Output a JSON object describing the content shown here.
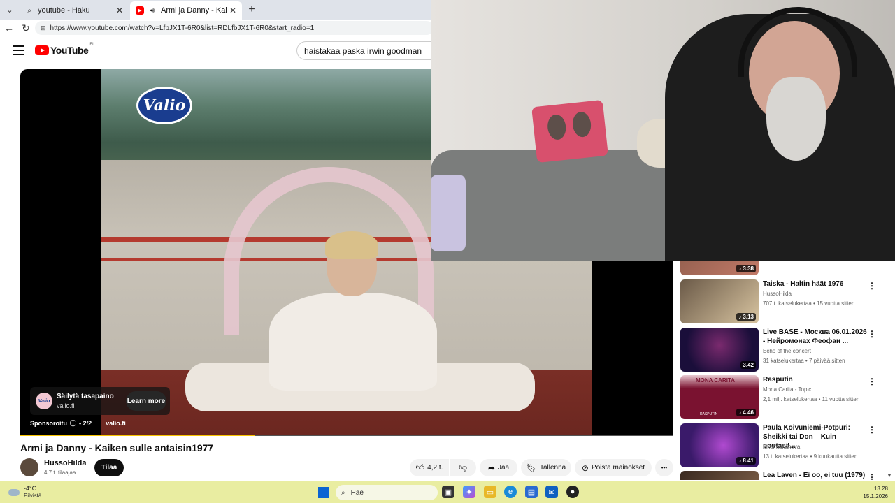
{
  "browser": {
    "tabs": [
      {
        "title": "youtube - Haku",
        "active": false
      },
      {
        "title": "Armi ja Danny - Kaiken sulle a",
        "active": true
      }
    ],
    "url": "https://www.youtube.com/watch?v=LfbJX1T-6R0&list=RDLfbJX1T-6R0&start_radio=1"
  },
  "youtube": {
    "logo": "YouTube",
    "region": "FI",
    "search_query": "haistakaa paska irwin goodman"
  },
  "ad": {
    "brand_logo_text": "Valio",
    "card_title": "Säilytä tasapaino",
    "card_domain": "valio.fi",
    "avatar_text": "Valio",
    "learn_more": "Learn more",
    "sponsored": "Sponsoroitu",
    "info_icon": "ⓘ",
    "counter": "• 2/2",
    "domain": "valio.fi",
    "progress": 0.36
  },
  "video": {
    "title": "Armi ja Danny - Kaiken sulle antaisin1977",
    "channel": "HussoHilda",
    "subscribers": "4,7 t. tilaajaa",
    "subscribe_label": "Tilaa",
    "like_count": "4,2 t.",
    "share_label": "Jaa",
    "save_label": "Tallenna",
    "remove_ads_label": "Poista mainokset",
    "more_label": "•••"
  },
  "recommendations": [
    {
      "title": "",
      "channel": "",
      "meta": "",
      "duration": "3.38",
      "thumb_colors": [
        "#8a5a4a",
        "#c27a68"
      ]
    },
    {
      "title": "Taiska - Haltin häät 1976",
      "channel": "HussoHilda",
      "meta": "707 t. katselukertaa • 15 vuotta sitten",
      "duration": "3.13",
      "thumb_colors": [
        "#6b5a48",
        "#d8c4a0"
      ]
    },
    {
      "title": "Live BASE - Москва 06.01.2026 - Нейромонах Феофан ...",
      "channel": "Echo of the concert",
      "meta": "31 katselukertaa • 7 päivää sitten",
      "duration": "3.42",
      "thumb_colors": [
        "#1a0e3a",
        "#7a2a6e"
      ]
    },
    {
      "title": "Rasputin",
      "channel": "Mona Carita - Topic",
      "meta": "2,1 milj. katselukertaa • 11 vuotta sitten",
      "duration": "4.46",
      "thumb_colors": [
        "#7a1230",
        "#e8c9d0"
      ]
    },
    {
      "title": "Paula Koivuniemi-Potpuri: Sheikki tai Don – Kuin poutasä...",
      "channel": "Iskelmäkanava",
      "meta": "13 t. katselukertaa • 9 kuukautta sitten",
      "duration": "8.41",
      "thumb_colors": [
        "#3a1a6a",
        "#b04ad0"
      ]
    },
    {
      "title": "Lea Laven - Ei oo, ei tuu (1979)",
      "channel": "",
      "meta": "",
      "duration": "",
      "thumb_colors": [
        "#3a2a20",
        "#8a6a50"
      ]
    }
  ],
  "thumb_labels": {
    "rasputin_banner": "MONA CARITA",
    "rasputin_caption": "RASPUTIN"
  },
  "taskbar": {
    "temperature": "-4°C",
    "condition": "Pilvistä",
    "search_placeholder": "Hae",
    "time": "13.28",
    "date": "15.1.2026"
  },
  "colors": {
    "youtube_red": "#ff0000",
    "progress": "#f8c400",
    "taskbar": "#e9eda1"
  }
}
